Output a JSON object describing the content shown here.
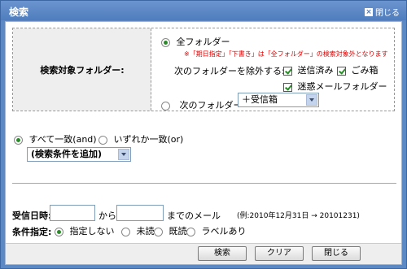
{
  "title": "検索",
  "close_top_label": "閉じる",
  "folder_section": {
    "label": "検索対象フォルダー:",
    "all_folders_label": "全フォルダー",
    "note": "※「期日指定」「下書き」は「全フォルダー」の検索対象外となります",
    "exclude_label": "次のフォルダーを除外する:",
    "exclude_options": [
      {
        "label": "送信済み",
        "checked": true
      },
      {
        "label": "ごみ箱",
        "checked": true
      },
      {
        "label": "迷惑メールフォルダー",
        "checked": true
      }
    ],
    "specific_folder_label": "次のフォルダー",
    "specific_folder_value": "＋受信箱"
  },
  "match": {
    "all_label": "すべて一致(and)",
    "any_label": "いずれか一致(or)",
    "add_condition_label": "(検索条件を追加)"
  },
  "date": {
    "label": "受信日時:",
    "from_text": "から",
    "until_text": "までのメール",
    "example": "(例:2010年12月31日 → 20101231)"
  },
  "condition": {
    "label": "条件指定:",
    "options": [
      "指定しない",
      "未読",
      "既読",
      "ラベルあり"
    ],
    "selected": "指定しない"
  },
  "buttons": {
    "search": "検索",
    "clear": "クリア",
    "close": "閉じる"
  }
}
